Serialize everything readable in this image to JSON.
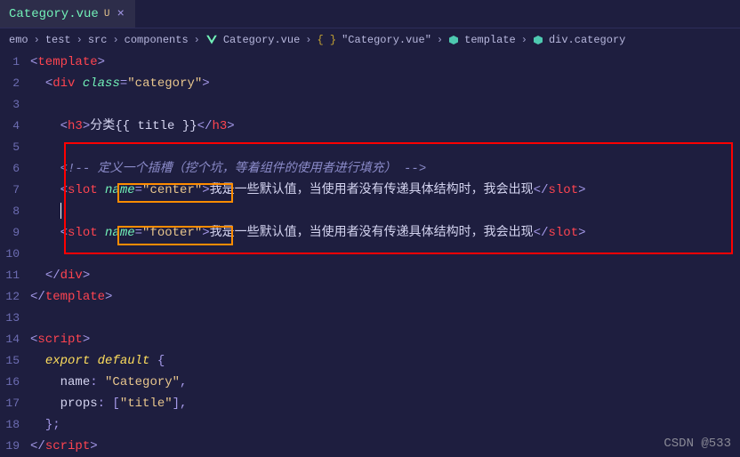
{
  "tab": {
    "name": "Category.vue",
    "modified": "U",
    "close": "×"
  },
  "breadcrumb": {
    "items": [
      "emo",
      "test",
      "src",
      "components",
      "Category.vue",
      "\"Category.vue\"",
      "template",
      "div.category"
    ]
  },
  "code": {
    "l1": {
      "tag": "template"
    },
    "l2": {
      "tag": "div",
      "attr": "class",
      "val": "\"category\""
    },
    "l4": {
      "tag": "h3",
      "txt": "分类",
      "mustache": "{{ title }}"
    },
    "l6": {
      "comment": "<!-- 定义一个插槽（挖个坑，等着组件的使用者进行填充） -->"
    },
    "l7": {
      "tag": "slot",
      "attr": "name",
      "val": "\"center\"",
      "txt": "我是一些默认值，当使用者没有传递具体结构时，我会出现"
    },
    "l9": {
      "tag": "slot",
      "attr": "name",
      "val": "\"footer\"",
      "txt": "我是一些默认值，当使用者没有传递具体结构时，我会出现"
    },
    "l11": {
      "tag": "div"
    },
    "l12": {
      "tag": "template"
    },
    "l14": {
      "tag": "script"
    },
    "l15": {
      "kw1": "export",
      "kw2": "default",
      "brace": "{"
    },
    "l16": {
      "key": "name",
      "val": "\"Category\""
    },
    "l17": {
      "key": "props",
      "val": "\"title\""
    },
    "l18": {
      "brace": "};"
    },
    "l19": {
      "tag": "script"
    }
  },
  "watermark": "CSDN @533"
}
